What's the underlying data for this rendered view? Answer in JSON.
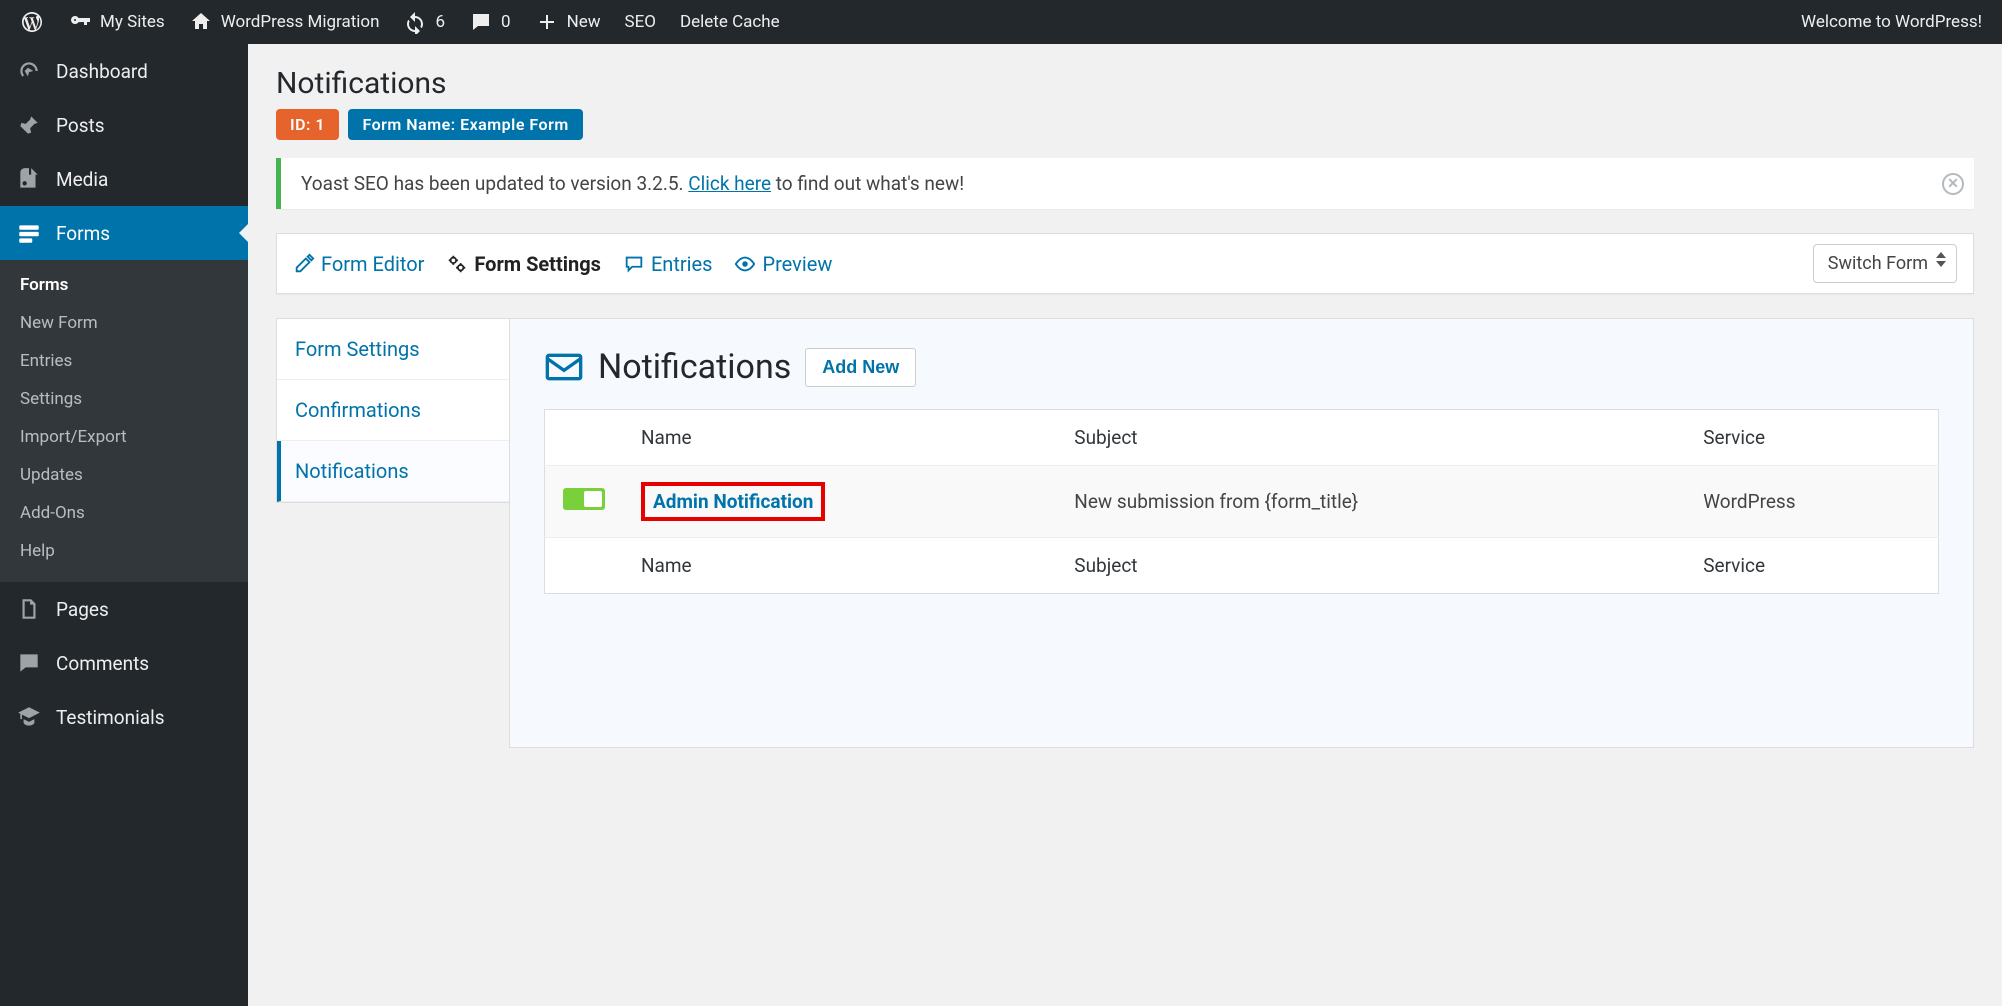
{
  "adminbar": {
    "my_sites": "My Sites",
    "site_name": "WordPress Migration",
    "updates": "6",
    "comments": "0",
    "new": "New",
    "seo": "SEO",
    "delete_cache": "Delete Cache",
    "welcome": "Welcome to WordPress!"
  },
  "menu": {
    "dashboard": "Dashboard",
    "posts": "Posts",
    "media": "Media",
    "forms": "Forms",
    "forms_sub": {
      "forms": "Forms",
      "new_form": "New Form",
      "entries": "Entries",
      "settings": "Settings",
      "import_export": "Import/Export",
      "updates": "Updates",
      "addons": "Add-Ons",
      "help": "Help"
    },
    "pages": "Pages",
    "comments": "Comments",
    "testimonials": "Testimonials"
  },
  "page": {
    "title": "Notifications",
    "id_badge": "ID: 1",
    "name_badge": "Form Name: Example Form",
    "notice_text_pre": "Yoast SEO has been updated to version 3.2.5. ",
    "notice_link": "Click here",
    "notice_text_post": " to find out what's new!"
  },
  "nav": {
    "form_editor": "Form Editor",
    "form_settings": "Form Settings",
    "entries": "Entries",
    "preview": "Preview",
    "switch_form": "Switch Form"
  },
  "tabs": {
    "form_settings": "Form Settings",
    "confirmations": "Confirmations",
    "notifications": "Notifications"
  },
  "section": {
    "title": "Notifications",
    "add_new": "Add New"
  },
  "table": {
    "headers": {
      "name": "Name",
      "subject": "Subject",
      "service": "Service"
    },
    "rows": [
      {
        "name": "Admin Notification",
        "subject": "New submission from {form_title}",
        "service": "WordPress"
      }
    ]
  }
}
